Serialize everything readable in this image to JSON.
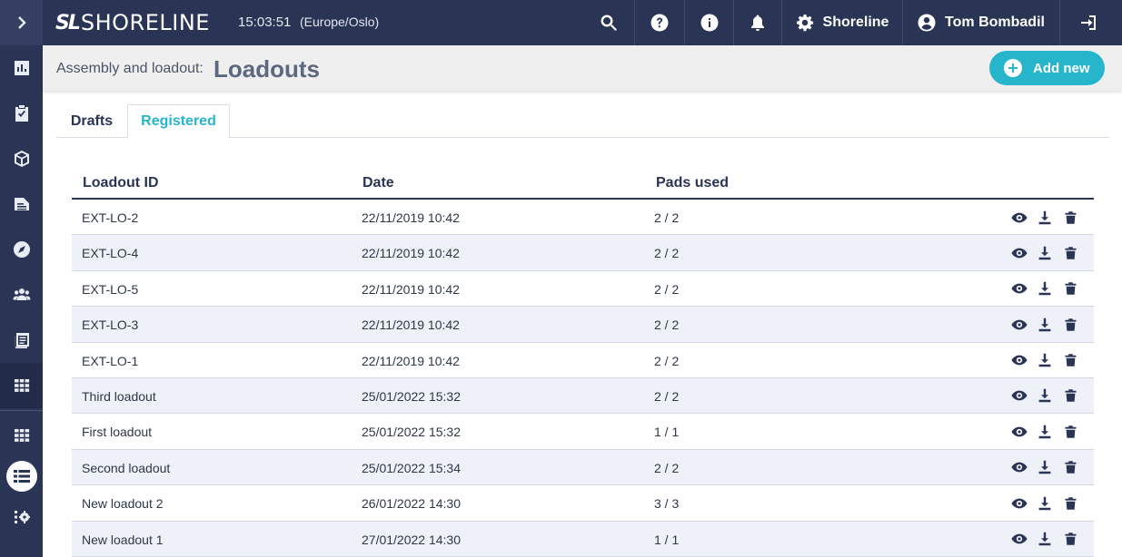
{
  "app": {
    "logo_mark": "SL",
    "logo_text": "SHORELINE",
    "time": "15:03:51",
    "timezone": "(Europe/Oslo)"
  },
  "topbar": {
    "org_label": "Shoreline",
    "user_label": "Tom Bombadil"
  },
  "sidebar": {
    "items": [
      {
        "name": "expand",
        "icon": "chevron-right-icon"
      },
      {
        "name": "dashboard",
        "icon": "bar-chart-icon"
      },
      {
        "name": "tasks",
        "icon": "clipboard-check-icon"
      },
      {
        "name": "inventory",
        "icon": "cube-icon"
      },
      {
        "name": "documents",
        "icon": "file-text-icon"
      },
      {
        "name": "navigation",
        "icon": "compass-icon"
      },
      {
        "name": "users",
        "icon": "users-icon"
      },
      {
        "name": "calendar",
        "icon": "calendar-list-icon"
      },
      {
        "name": "assembly",
        "icon": "grid-icon"
      },
      {
        "name": "modules",
        "icon": "grid-icon"
      },
      {
        "name": "loadouts",
        "icon": "list-table-icon"
      },
      {
        "name": "settings",
        "icon": "settings-list-icon"
      }
    ]
  },
  "header": {
    "breadcrumb": "Assembly and loadout:",
    "title": "Loadouts",
    "add_button": "Add new"
  },
  "tabs": [
    {
      "label": "Drafts",
      "active": false
    },
    {
      "label": "Registered",
      "active": true
    }
  ],
  "table": {
    "columns": [
      "Loadout ID",
      "Date",
      "Pads used"
    ],
    "rows": [
      {
        "id": "EXT-LO-2",
        "date": "22/11/2019 10:42",
        "pads": "2 / 2"
      },
      {
        "id": "EXT-LO-4",
        "date": "22/11/2019 10:42",
        "pads": "2 / 2"
      },
      {
        "id": "EXT-LO-5",
        "date": "22/11/2019 10:42",
        "pads": "2 / 2"
      },
      {
        "id": "EXT-LO-3",
        "date": "22/11/2019 10:42",
        "pads": "2 / 2"
      },
      {
        "id": "EXT-LO-1",
        "date": "22/11/2019 10:42",
        "pads": "2 / 2"
      },
      {
        "id": "Third loadout",
        "date": "25/01/2022 15:32",
        "pads": "2 / 2"
      },
      {
        "id": "First loadout",
        "date": "25/01/2022 15:32",
        "pads": "1 / 1"
      },
      {
        "id": "Second loadout",
        "date": "25/01/2022 15:34",
        "pads": "2 / 2"
      },
      {
        "id": "New loadout 2",
        "date": "26/01/2022 14:30",
        "pads": "3 / 3"
      },
      {
        "id": "New loadout 1",
        "date": "27/01/2022 14:30",
        "pads": "1 / 1"
      }
    ]
  },
  "colors": {
    "navy": "#2a3454",
    "accent": "#27b5cc",
    "row_alt": "#eef1f8",
    "header_band": "#efefef"
  }
}
